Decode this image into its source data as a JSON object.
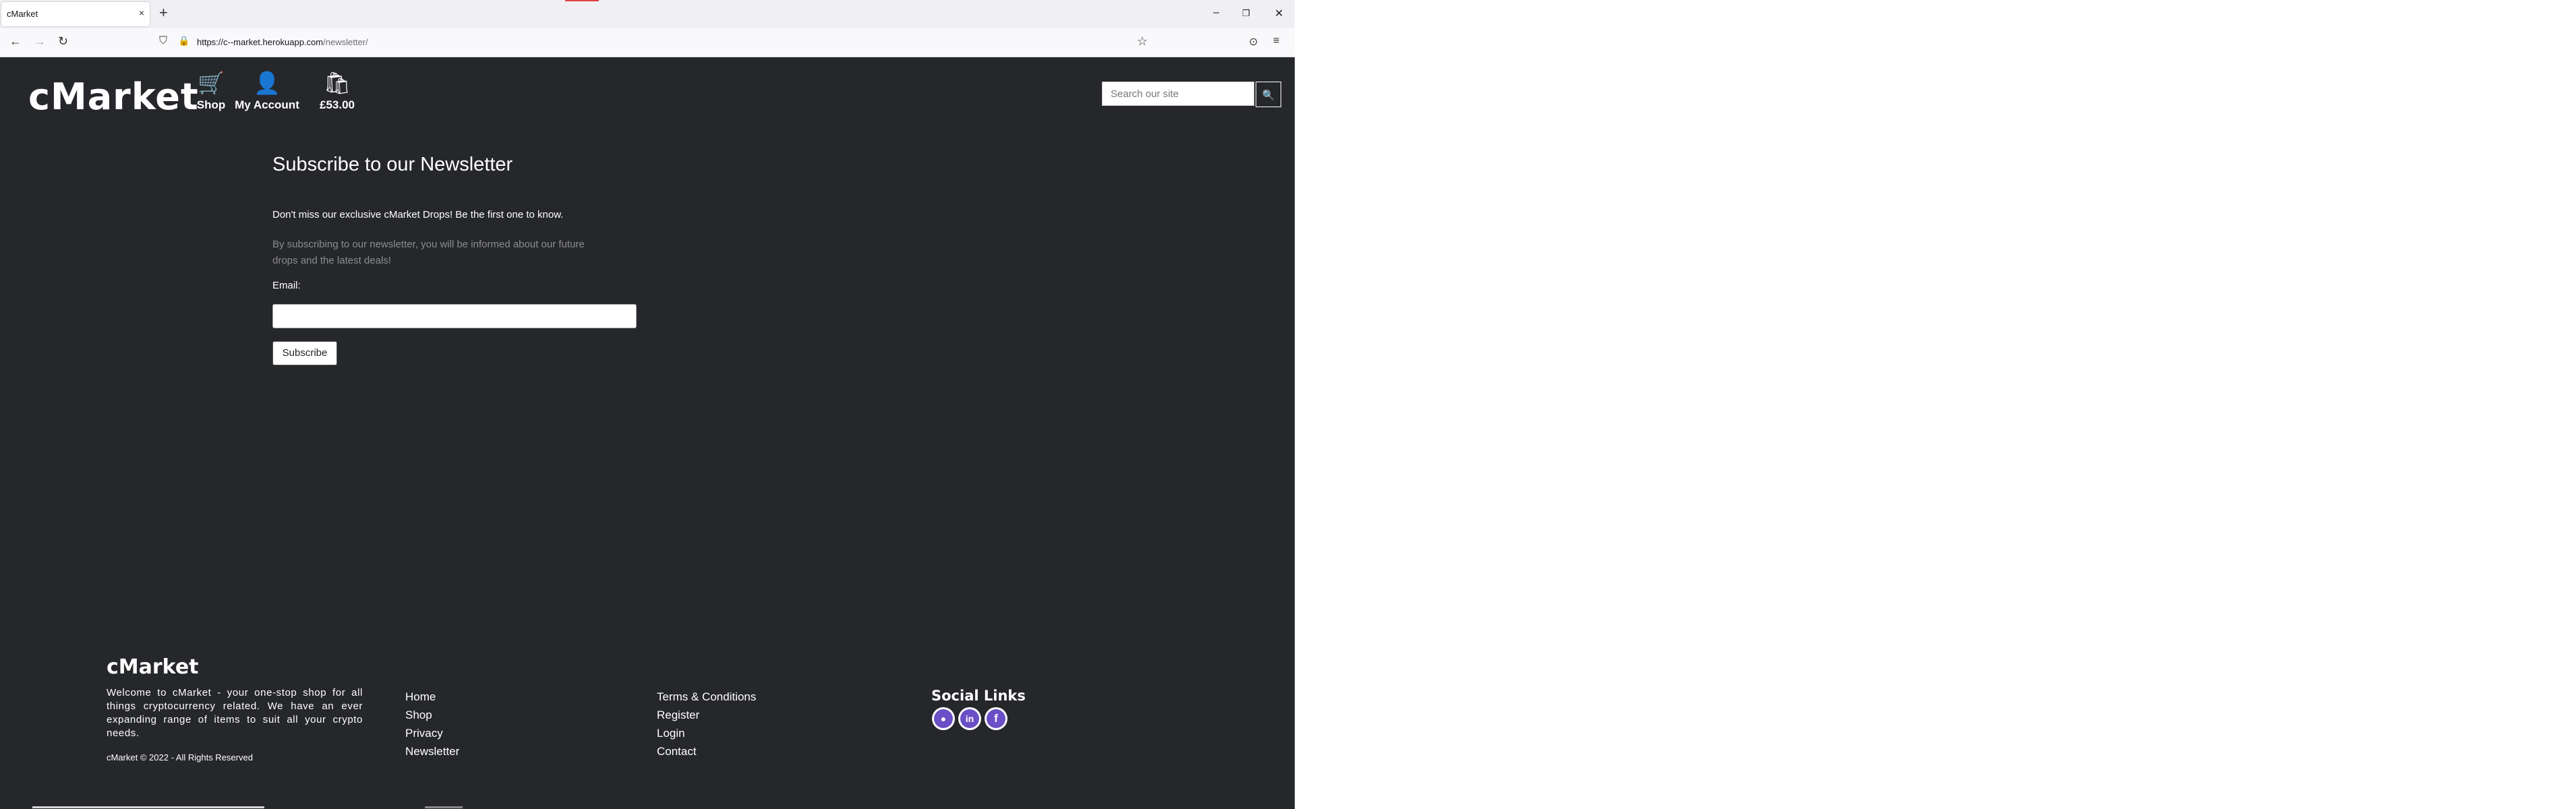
{
  "browser": {
    "tab_title": "cMarket",
    "tab_close": "×",
    "new_tab": "+",
    "window_controls": {
      "minimize": "–",
      "restore": "❐",
      "close": "✕"
    },
    "url_host": "https://c--market.herokuapp.com",
    "url_path": "/newsletter/",
    "icons": {
      "back": "←",
      "forward": "→",
      "reload": "↻",
      "shield": "⛉",
      "lock": "🔒",
      "star": "☆",
      "pocket": "⊙",
      "menu": "≡"
    }
  },
  "header": {
    "logo": "cMarket",
    "nav": [
      {
        "label": "Shop",
        "icon": "cart-icon",
        "glyph": "🛒"
      },
      {
        "label": "My Account",
        "icon": "user-icon",
        "glyph": "👤"
      },
      {
        "label": "£53.00",
        "icon": "bag-icon",
        "glyph": "🛍"
      }
    ],
    "search_placeholder": "Search our site",
    "search_glyph": "🔍"
  },
  "main": {
    "title": "Subscribe to our Newsletter",
    "lead": "Don't miss our exclusive cMarket Drops! Be the first one to know.",
    "info": "By subscribing to our newsletter, you will be informed about our future drops and the latest deals!",
    "email_label": "Email:",
    "email_value": "",
    "subscribe_label": "Subscribe"
  },
  "footer": {
    "logo": "cMarket",
    "description": "Welcome to cMarket - your one-stop shop for all things cryptocurrency related. We have an ever expanding range of items to suit all your crypto needs.",
    "copyright": "cMarket © 2022 - All Rights Reserved",
    "links_col1": [
      "Home",
      "Shop",
      "Privacy",
      "Newsletter"
    ],
    "links_col2": [
      "Terms & Conditions",
      "Register",
      "Login",
      "Contact"
    ],
    "social_title": "Social Links",
    "social": [
      {
        "name": "github-icon",
        "glyph": "●"
      },
      {
        "name": "linkedin-icon",
        "glyph": "in"
      },
      {
        "name": "facebook-icon",
        "glyph": "f"
      }
    ],
    "accent_color": "#6a4fc6"
  }
}
